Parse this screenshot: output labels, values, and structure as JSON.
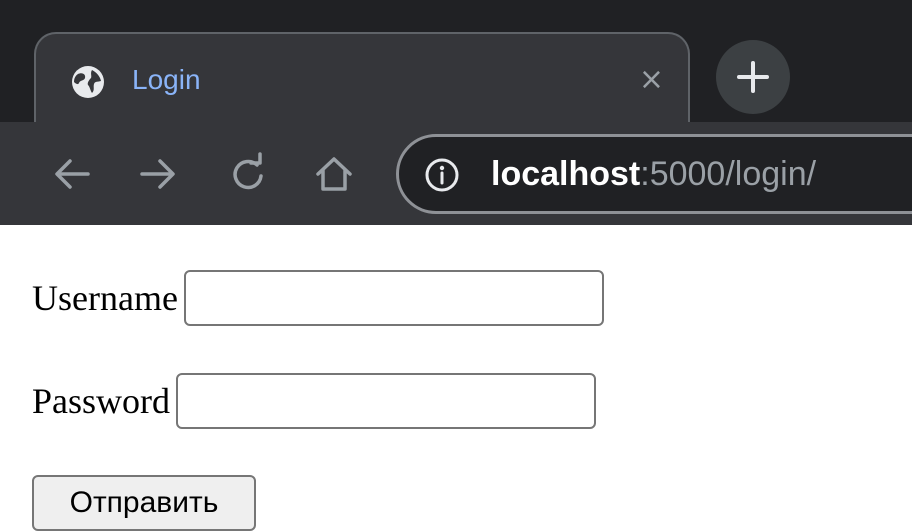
{
  "browser": {
    "tab": {
      "title": "Login",
      "favicon": "globe-icon",
      "close_label": "×"
    },
    "new_tab_icon": "plus-icon",
    "nav_icons": [
      "back-arrow-icon",
      "forward-arrow-icon",
      "reload-icon",
      "home-icon"
    ],
    "address_bar": {
      "security_icon": "info-icon",
      "host": "localhost",
      "rest": ":5000/login/"
    },
    "colors": {
      "chrome_dark": "#202124",
      "toolbar": "#35363a",
      "tab_title": "#8ab4f8",
      "icon": "#9aa0a6"
    }
  },
  "form": {
    "username_label": "Username",
    "username_value": "",
    "password_label": "Password",
    "password_value": "",
    "submit_label": "Отправить"
  }
}
